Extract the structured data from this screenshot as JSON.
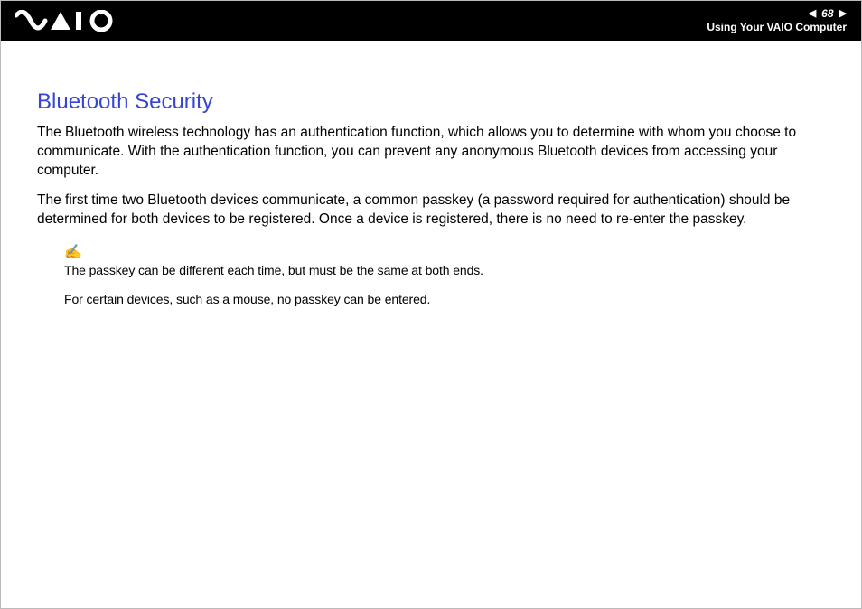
{
  "header": {
    "page_number": "68",
    "section": "Using Your VAIO Computer"
  },
  "content": {
    "heading": "Bluetooth Security",
    "para1": "The Bluetooth wireless technology has an authentication function, which allows you to determine with whom you choose to communicate. With the authentication function, you can prevent any anonymous Bluetooth devices from accessing your computer.",
    "para2": "The first time two Bluetooth devices communicate, a common passkey (a password required for authentication) should be determined for both devices to be registered. Once a device is registered, there is no need to re-enter the passkey.",
    "note_icon": "✍",
    "note1": "The passkey can be different each time, but must be the same at both ends.",
    "note2": "For certain devices, such as a mouse, no passkey can be entered."
  }
}
